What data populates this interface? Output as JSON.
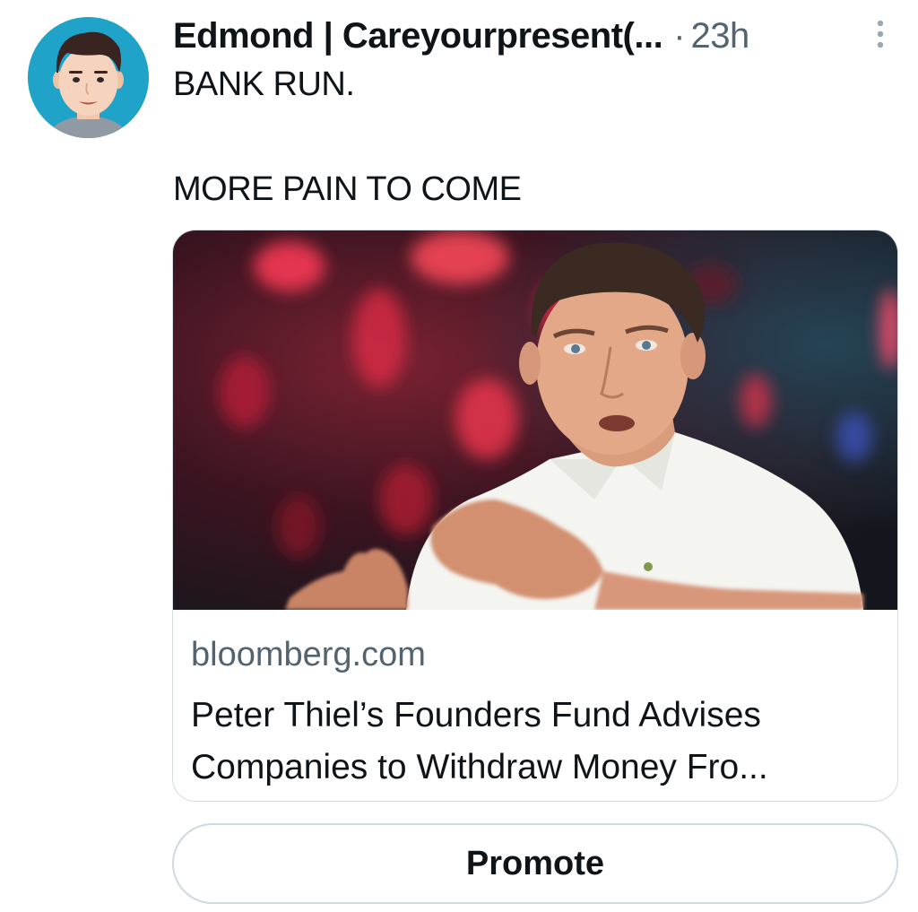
{
  "tweet": {
    "author": {
      "display_name": "Edmond | Careyourpresent(...",
      "avatar_icon": "cartoon-avatar-icon"
    },
    "separator": "·",
    "time": "23h",
    "more_icon": "more-vertical-icon",
    "text_lines": [
      "BANK RUN.",
      "MORE PAIN TO COME"
    ]
  },
  "link_card": {
    "image_icon": "article-photo",
    "domain": "bloomberg.com",
    "title_lines": [
      "Peter Thiel’s Founders Fund Advises",
      "Companies to Withdraw Money Fro..."
    ]
  },
  "actions": {
    "promote_label": "Promote"
  },
  "colors": {
    "text_primary": "#0f1419",
    "text_secondary": "#536471",
    "border": "#cfd9de",
    "avatar_bg": "#1fa3c9"
  }
}
